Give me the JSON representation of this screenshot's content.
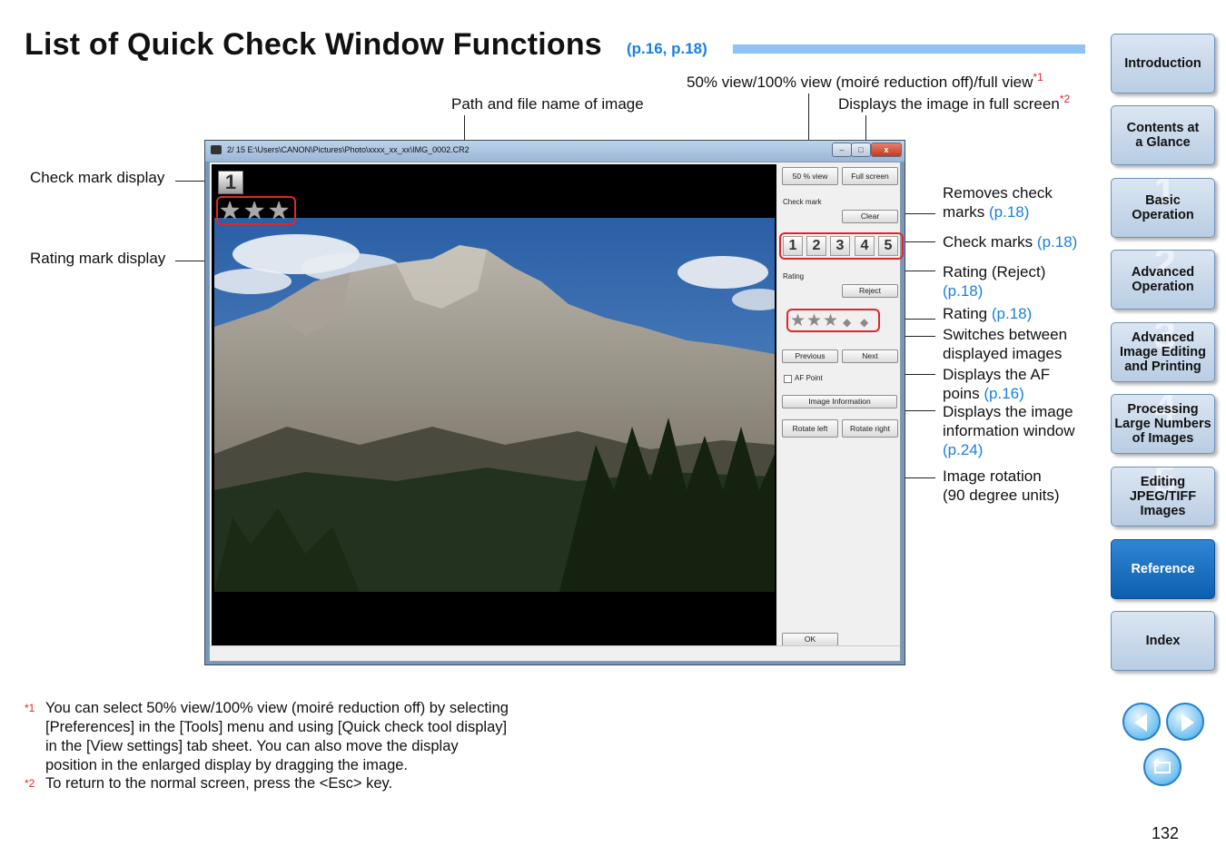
{
  "title": "List of Quick Check Window Functions",
  "title_ref": "(p.16, p.18)",
  "callouts": {
    "view_toggle": "50% view/100% view (moiré reduction off)/full view",
    "view_toggle_note": "*1",
    "path": "Path and file name of image",
    "full_screen": "Displays the image in full screen",
    "full_screen_note": "*2",
    "check_mark_display": "Check mark display",
    "rating_mark_display": "Rating mark display",
    "removes_check_1": "Removes check",
    "removes_check_2": "marks",
    "removes_check_ref": "(p.18)",
    "check_marks": "Check marks",
    "check_marks_ref": "(p.18)",
    "rating_reject": "Rating (Reject)",
    "rating_reject_ref": "(p.18)",
    "rating": "Rating",
    "rating_ref": "(p.18)",
    "switches_1": "Switches between",
    "switches_2": "displayed images",
    "af_1": "Displays the AF",
    "af_2": "poins",
    "af_ref": "(p.16)",
    "info_1": "Displays the image",
    "info_2": "information window",
    "info_ref": "(p.24)",
    "rotation_1": "Image rotation",
    "rotation_2": "(90 degree units)"
  },
  "window": {
    "title_text": "2/ 15  E:\\Users\\CANON\\Pictures\\Photo\\xxxx_xx_xx\\IMG_0002.CR2",
    "btn_min": "–",
    "btn_max": "□",
    "btn_close": "x",
    "check_overlay": "1",
    "panel": {
      "view_btn": "50 % view",
      "fullscreen_btn": "Full screen",
      "check_mark_label": "Check mark",
      "clear_btn": "Clear",
      "check_numbers": [
        "1",
        "2",
        "3",
        "4",
        "5"
      ],
      "rating_label": "Rating",
      "reject_btn": "Reject",
      "previous_btn": "Previous",
      "next_btn": "Next",
      "af_point_label": "AF Point",
      "info_btn": "Image Information",
      "rotate_left_btn": "Rotate left",
      "rotate_right_btn": "Rotate right",
      "ok_btn": "OK"
    },
    "rating_stars_selected": 3,
    "rating_stars_total": 5
  },
  "footnotes": [
    {
      "mark": "*1",
      "lines": [
        "You can select 50% view/100% view (moiré reduction off) by selecting",
        "[Preferences] in the [Tools] menu and using [Quick check tool display]",
        "in the [View settings] tab sheet. You can also move the display",
        "position in the enlarged display by dragging the image."
      ]
    },
    {
      "mark": "*2",
      "lines": [
        "To return to the normal screen, press the <Esc> key."
      ]
    }
  ],
  "nav": {
    "introduction": "Introduction",
    "contents_1": "Contents at",
    "contents_2": "a Glance",
    "basic_1": "Basic",
    "basic_2": "Operation",
    "basic_num": "1",
    "advanced_1": "Advanced",
    "advanced_2": "Operation",
    "advanced_num": "2",
    "adv_edit_1": "Advanced",
    "adv_edit_2": "Image Editing",
    "adv_edit_3": "and Printing",
    "adv_edit_num": "3",
    "processing_1": "Processing",
    "processing_2": "Large Numbers",
    "processing_3": "of Images",
    "processing_num": "4",
    "editing_1": "Editing",
    "editing_2": "JPEG/TIFF",
    "editing_3": "Images",
    "editing_num": "5",
    "reference": "Reference",
    "index": "Index"
  },
  "page_number": "132",
  "colors": {
    "accent_blue": "#1a7fe0",
    "callout_red": "#e0262a",
    "nav_active": "#0c5fae",
    "nav_inactive": "#c6d6e8"
  }
}
